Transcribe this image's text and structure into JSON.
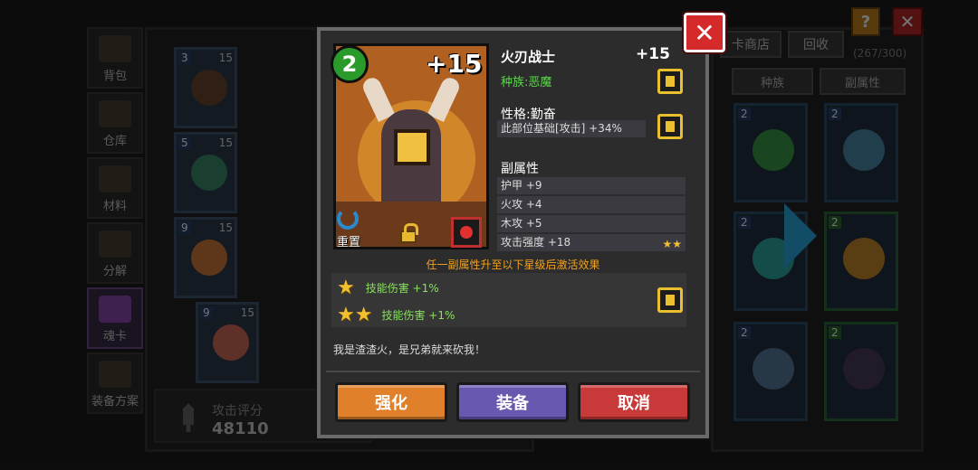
{
  "sidebar": {
    "items": [
      {
        "label": "背包"
      },
      {
        "label": "仓库"
      },
      {
        "label": "材料"
      },
      {
        "label": "分解"
      },
      {
        "label": "魂卡"
      },
      {
        "label": "装备方案"
      }
    ]
  },
  "left_cards": [
    {
      "level": "3",
      "max": "15"
    },
    {
      "level": "5",
      "max": "15"
    },
    {
      "level": "9",
      "max": "15"
    },
    {
      "level": "9",
      "max": "15"
    }
  ],
  "score": {
    "label": "攻击评分",
    "value": "48110"
  },
  "shop": {
    "shop_label": "卡商店",
    "recycle_label": "回收",
    "count": "(267/300)"
  },
  "filters": {
    "race": "种族",
    "sub_attr": "副属性"
  },
  "grid_cards": [
    {
      "level": "2"
    },
    {
      "level": "2"
    },
    {
      "level": "2"
    },
    {
      "level": "2"
    },
    {
      "level": "2"
    },
    {
      "level": "2"
    }
  ],
  "top": {
    "help": "?",
    "close": "✕"
  },
  "modal": {
    "close": "✕",
    "card_level": "2",
    "card_plus": "+15",
    "reset_label": "重置",
    "name": "火刃战士",
    "plus": "+15",
    "race": "种族:恶魔",
    "trait": "性格:勤奋",
    "trait_effect": "此部位基础[攻击] +34%",
    "sub_title": "副属性",
    "sub_stats": [
      {
        "text": "护甲 +9",
        "stars": ""
      },
      {
        "text": "火攻 +4",
        "stars": ""
      },
      {
        "text": "木攻 +5",
        "stars": ""
      },
      {
        "text": "攻击强度 +18",
        "stars": "★★"
      }
    ],
    "hint": "任一副属性升至以下星级后激活效果",
    "skills": [
      {
        "stars": "★",
        "text": "技能伤害 +1%"
      },
      {
        "stars": "★★",
        "text": "技能伤害 +1%"
      }
    ],
    "quote": "我是渣渣火，是兄弟就来砍我！",
    "buttons": {
      "upgrade": "强化",
      "equip": "装备",
      "cancel": "取消"
    }
  },
  "colors": {
    "upgrade": "#e0802a",
    "equip": "#6a58b0",
    "cancel": "#c83a3a",
    "race": "#5ad84a",
    "hint": "#f0a020"
  }
}
